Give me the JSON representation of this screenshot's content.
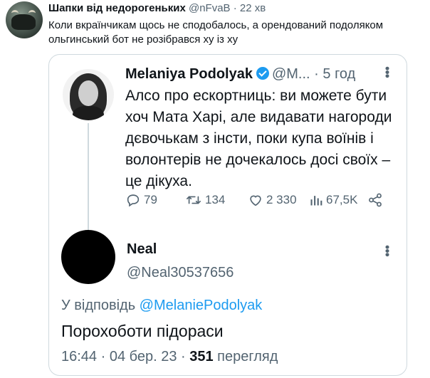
{
  "outer": {
    "name": "Шапки від недорогеньких",
    "handle_time": " @nFvaB · 22 хв",
    "text": "Коли вкраїнчикам щось не сподобалось, а орендований подоляком ольгинський бот не розібрався ху із ху"
  },
  "quoted": {
    "name": "Melaniya Podolyak",
    "handle": "@M...",
    "time": " · 5 год",
    "text": "Алсо про ескортниць: ви можете бути хоч Мата Харі, але видавати нагороди дєвочькам з інсти, поки купа воїнів і волонтерів не дочекалось досі своїх – це дікуха.",
    "stats": {
      "replies": "79",
      "retweets": "134",
      "likes": "2 330",
      "views": "67,5K"
    }
  },
  "reply": {
    "name": "Neal",
    "handle": "@Neal30537656",
    "reply_label": "У відповідь",
    "reply_link": " @MelaniePodolyak",
    "text": "Порохоботи підораси",
    "time_date": "16:44 · 04 бер. 23 · ",
    "views_count": "351",
    "views_label": " перегляд"
  },
  "icons": {
    "more": "more-icon",
    "reply": "reply-icon",
    "retweet": "retweet-icon",
    "like": "heart-icon",
    "views": "views-icon",
    "share": "share-icon",
    "verified": "verified-icon"
  },
  "colors": {
    "accent": "#1d9bf0",
    "text": "#0f1419",
    "muted": "#536471",
    "border": "#cfd9de"
  }
}
